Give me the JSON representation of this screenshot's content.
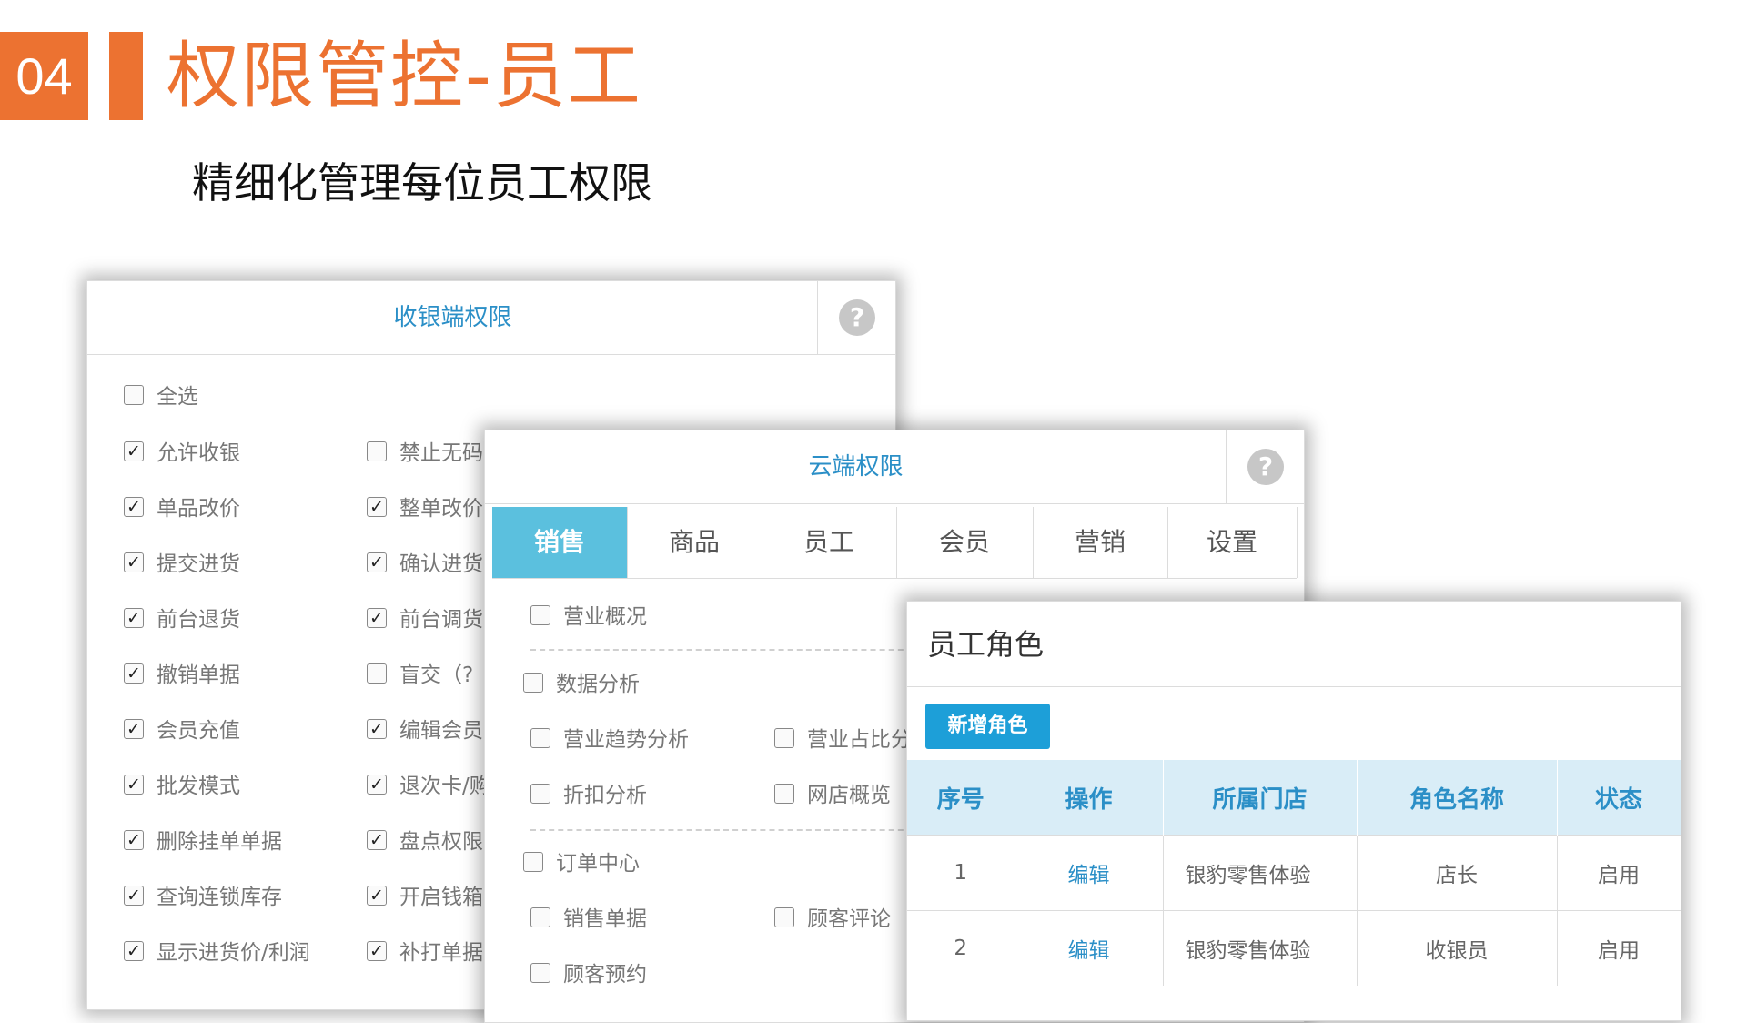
{
  "header": {
    "number": "04",
    "title": "权限管控-员工",
    "subtitle": "精细化管理每位员工权限"
  },
  "colors": {
    "accent": "#ec7231",
    "link": "#2b8fc7",
    "tab_active": "#5bc0de",
    "button": "#1d9fd8"
  },
  "cashier": {
    "title": "收银端权限",
    "help_icon": "?",
    "select_all": {
      "label": "全选",
      "checked": false
    },
    "left": [
      {
        "label": "允许收银",
        "checked": true
      },
      {
        "label": "单品改价",
        "checked": true
      },
      {
        "label": "提交进货",
        "checked": true
      },
      {
        "label": "前台退货",
        "checked": true
      },
      {
        "label": "撤销单据",
        "checked": true
      },
      {
        "label": "会员充值",
        "checked": true
      },
      {
        "label": "批发模式",
        "checked": true
      },
      {
        "label": "删除挂单单据",
        "checked": true
      },
      {
        "label": "查询连锁库存",
        "checked": true
      },
      {
        "label": "显示进货价/利润",
        "checked": true
      }
    ],
    "right": [
      {
        "label": "禁止无码",
        "checked": false
      },
      {
        "label": "整单改价",
        "checked": true
      },
      {
        "label": "确认进货",
        "checked": true
      },
      {
        "label": "前台调货",
        "checked": true
      },
      {
        "label": "盲交（?",
        "checked": false
      },
      {
        "label": "编辑会员",
        "checked": true
      },
      {
        "label": "退次卡/购",
        "checked": true
      },
      {
        "label": "盘点权限",
        "checked": true
      },
      {
        "label": "开启钱箱",
        "checked": true
      },
      {
        "label": "补打单据",
        "checked": true
      }
    ]
  },
  "cloud": {
    "title": "云端权限",
    "help_icon": "?",
    "tabs": [
      "销售",
      "商品",
      "员工",
      "会员",
      "营销",
      "设置"
    ],
    "active_tab": "销售",
    "items": {
      "overview": "营业概况",
      "analysis": "数据分析",
      "trend": "营业趋势分析",
      "ratio": "营业占比分",
      "discount": "折扣分析",
      "shop": "网店概览",
      "orders": "订单中心",
      "sales_docs": "销售单据",
      "reviews": "顾客评论",
      "booking": "顾客预约"
    }
  },
  "roles": {
    "title": "员工角色",
    "add_button": "新增角色",
    "columns": [
      "序号",
      "操作",
      "所属门店",
      "角色名称",
      "状态"
    ],
    "rows": [
      {
        "no": "1",
        "action": "编辑",
        "store": "银豹零售体验",
        "role": "店长",
        "status": "启用"
      },
      {
        "no": "2",
        "action": "编辑",
        "store": "银豹零售体验",
        "role": "收银员",
        "status": "启用"
      }
    ]
  }
}
